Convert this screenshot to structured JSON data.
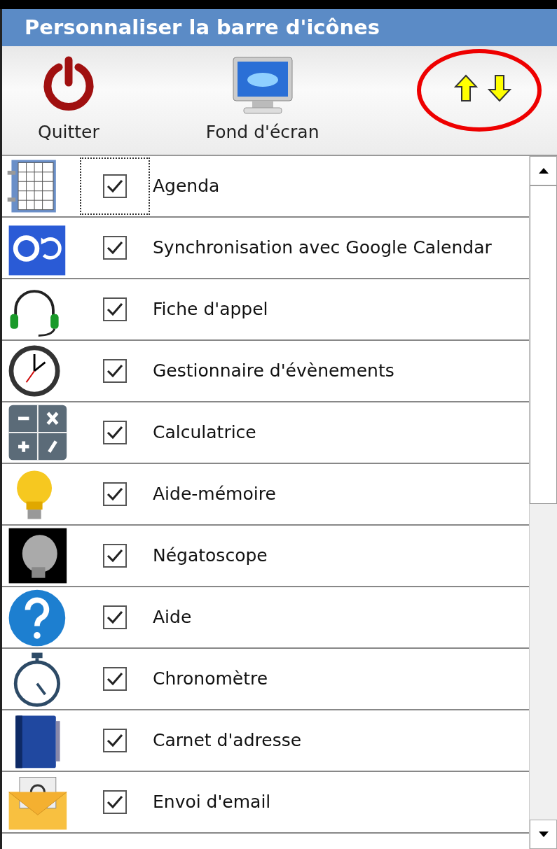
{
  "window": {
    "title": "Personnaliser la barre d'icônes"
  },
  "toolbar": {
    "buttons": [
      {
        "label": "Quitter"
      },
      {
        "label": "Fond d'écran"
      }
    ]
  },
  "items": [
    {
      "label": "Agenda",
      "checked": true,
      "focused": true
    },
    {
      "label": "Synchronisation avec Google Calendar",
      "checked": true,
      "focused": false
    },
    {
      "label": "Fiche d'appel",
      "checked": true,
      "focused": false
    },
    {
      "label": "Gestionnaire d'évènements",
      "checked": true,
      "focused": false
    },
    {
      "label": "Calculatrice",
      "checked": true,
      "focused": false
    },
    {
      "label": "Aide-mémoire",
      "checked": true,
      "focused": false
    },
    {
      "label": "Négatoscope",
      "checked": true,
      "focused": false
    },
    {
      "label": "Aide",
      "checked": true,
      "focused": false
    },
    {
      "label": "Chronomètre",
      "checked": true,
      "focused": false
    },
    {
      "label": "Carnet d'adresse",
      "checked": true,
      "focused": false
    },
    {
      "label": "Envoi d'email",
      "checked": true,
      "focused": false
    }
  ]
}
